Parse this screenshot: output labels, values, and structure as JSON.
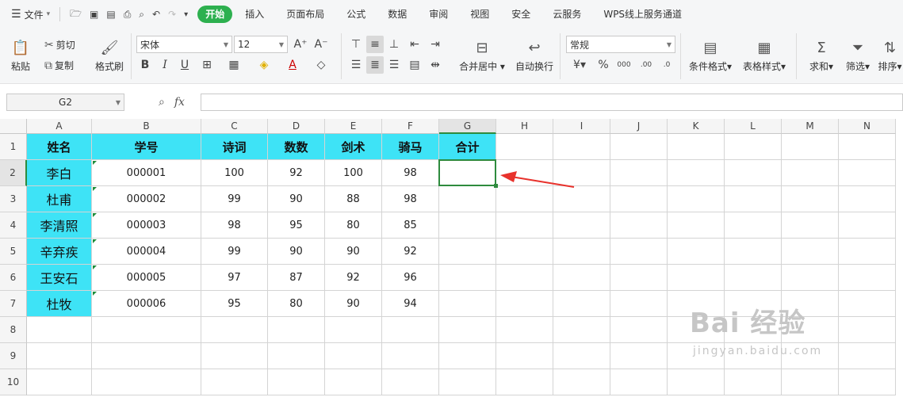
{
  "menubar": {
    "file_label": "文件",
    "tabs": [
      {
        "label": "开始",
        "active": true
      },
      {
        "label": "插入"
      },
      {
        "label": "页面布局"
      },
      {
        "label": "公式"
      },
      {
        "label": "数据"
      },
      {
        "label": "审阅"
      },
      {
        "label": "视图"
      },
      {
        "label": "安全"
      },
      {
        "label": "云服务"
      },
      {
        "label": "WPS线上服务通道"
      }
    ]
  },
  "ribbon": {
    "paste": "粘贴",
    "cut": "剪切",
    "copy": "复制",
    "format_painter": "格式刷",
    "font_name": "宋体",
    "font_size": "12",
    "merge_center": "合并居中",
    "wrap_text": "自动换行",
    "number_format": "常规",
    "conditional_format": "条件格式",
    "table_style": "表格样式",
    "sum": "求和",
    "filter": "筛选",
    "sort": "排序"
  },
  "formula": {
    "name_box": "G2",
    "fx": "fx",
    "value": ""
  },
  "sheet": {
    "columns": [
      "A",
      "B",
      "C",
      "D",
      "E",
      "F",
      "G",
      "H",
      "I",
      "J",
      "K",
      "L",
      "M",
      "N"
    ],
    "rows": [
      "1",
      "2",
      "3",
      "4",
      "5",
      "6",
      "7",
      "8",
      "9",
      "10"
    ],
    "header": [
      "姓名",
      "学号",
      "诗词",
      "数数",
      "剑术",
      "骑马",
      "合计"
    ],
    "data": [
      [
        "李白",
        "000001",
        "100",
        "92",
        "100",
        "98",
        ""
      ],
      [
        "杜甫",
        "000002",
        "99",
        "90",
        "88",
        "98",
        ""
      ],
      [
        "李清照",
        "000003",
        "98",
        "95",
        "80",
        "85",
        ""
      ],
      [
        "辛弃疾",
        "000004",
        "99",
        "90",
        "90",
        "92",
        ""
      ],
      [
        "王安石",
        "000005",
        "97",
        "87",
        "92",
        "96",
        ""
      ],
      [
        "杜牧",
        "000006",
        "95",
        "80",
        "90",
        "94",
        ""
      ]
    ],
    "header_fill": "#3ee3f6",
    "selected_cell": "G2",
    "selection_color": "#2e8b3e",
    "arrow_color": "#e8322c"
  },
  "watermark": {
    "main": "Bai 经验",
    "sub": "jingyan.baidu.com"
  }
}
